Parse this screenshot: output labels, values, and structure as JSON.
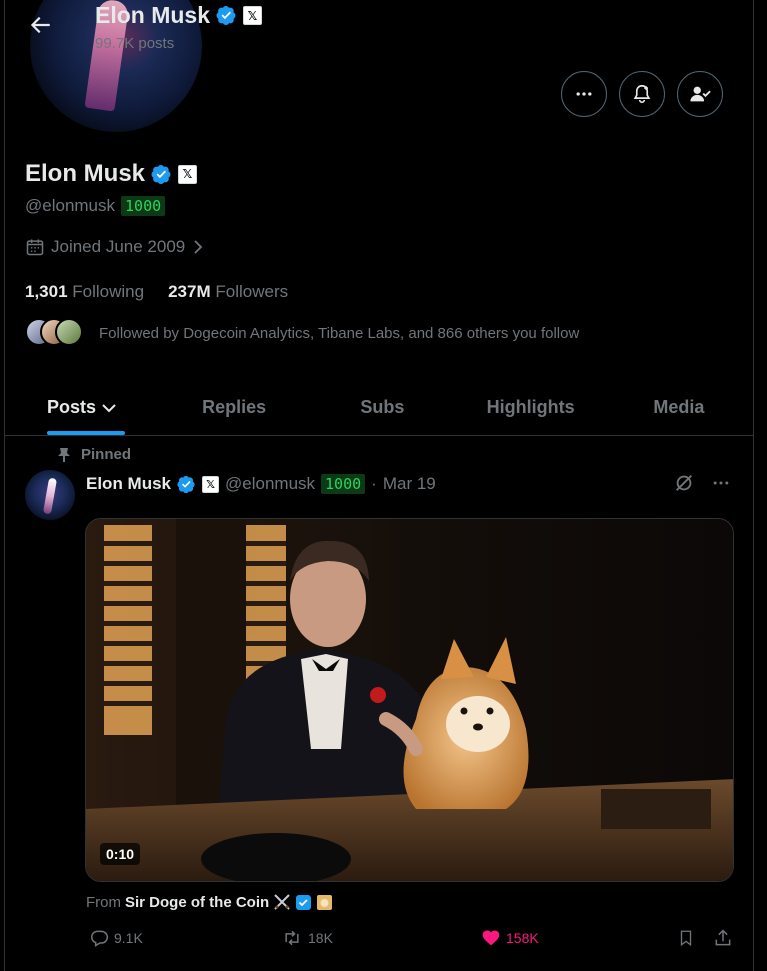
{
  "header": {
    "name": "Elon Musk",
    "posts": "99.7K posts"
  },
  "profile": {
    "name": "Elon Musk",
    "handle": "@elonmusk",
    "score": "1000",
    "x_badge": "𝕏",
    "joined": "Joined June 2009",
    "following_count": "1,301",
    "following_label": "Following",
    "followers_count": "237M",
    "followers_label": "Followers",
    "followed_by": "Followed by Dogecoin Analytics, Tibane Labs, and 866 others you follow"
  },
  "tabs": [
    "Posts",
    "Replies",
    "Subs",
    "Highlights",
    "Media"
  ],
  "tweet": {
    "pinned": "Pinned",
    "name": "Elon Musk",
    "handle": "@elonmusk",
    "score": "1000",
    "sep": "·",
    "date": "Mar 19",
    "duration": "0:10",
    "from_prefix": "From",
    "from_source": "Sir Doge of the Coin",
    "replies": "9.1K",
    "reposts": "18K",
    "likes": "158K"
  },
  "colors": {
    "accent": "#1d9bf0",
    "like": "#f91880",
    "score_bg": "#0d3a16",
    "score_fg": "#2bd25c"
  },
  "icons": [
    "back-arrow-icon",
    "verified-icon",
    "more-icon",
    "notify-icon",
    "following-icon",
    "calendar-icon",
    "chevron-right-icon",
    "pin-icon",
    "grok-icon",
    "reply-icon",
    "repost-icon",
    "like-icon",
    "bookmark-icon",
    "share-icon"
  ]
}
